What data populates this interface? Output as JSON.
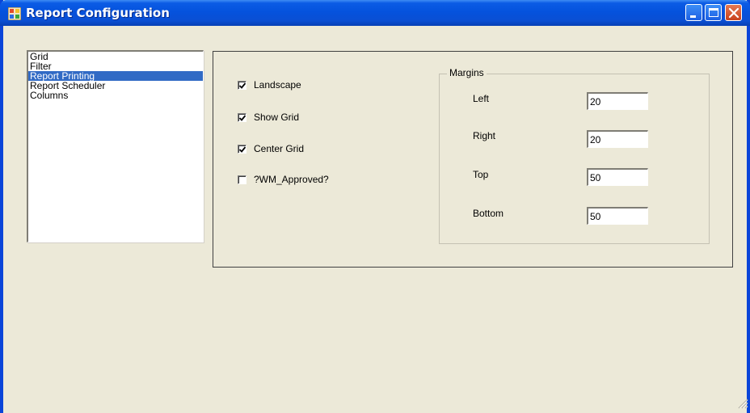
{
  "window": {
    "title": "Report Configuration"
  },
  "nav": {
    "items": [
      {
        "label": "Grid",
        "selected": false
      },
      {
        "label": "Filter",
        "selected": false
      },
      {
        "label": "Report Printing",
        "selected": true
      },
      {
        "label": "Report Scheduler",
        "selected": false
      },
      {
        "label": "Columns",
        "selected": false
      }
    ]
  },
  "options": {
    "landscape": {
      "label": "Landscape",
      "checked": true
    },
    "show_grid": {
      "label": "Show Grid",
      "checked": true
    },
    "center_grid": {
      "label": "Center Grid",
      "checked": true
    },
    "wm_approved": {
      "label": "?WM_Approved?",
      "checked": false
    }
  },
  "margins": {
    "group_label": "Margins",
    "left": {
      "label": "Left",
      "value": "20"
    },
    "right": {
      "label": "Right",
      "value": "20"
    },
    "top": {
      "label": "Top",
      "value": "50"
    },
    "bottom": {
      "label": "Bottom",
      "value": "50"
    }
  },
  "icons": {
    "app": "app-icon",
    "minimize": "minimize-icon",
    "maximize": "maximize-icon",
    "close": "close-icon",
    "checkmark": "checkmark-icon",
    "resize_grip": "resize-grip-icon"
  },
  "colors": {
    "titlebar": "#0552dd",
    "selection": "#316ac5",
    "window_bg": "#ece9d8",
    "close_button": "#c8401b"
  }
}
